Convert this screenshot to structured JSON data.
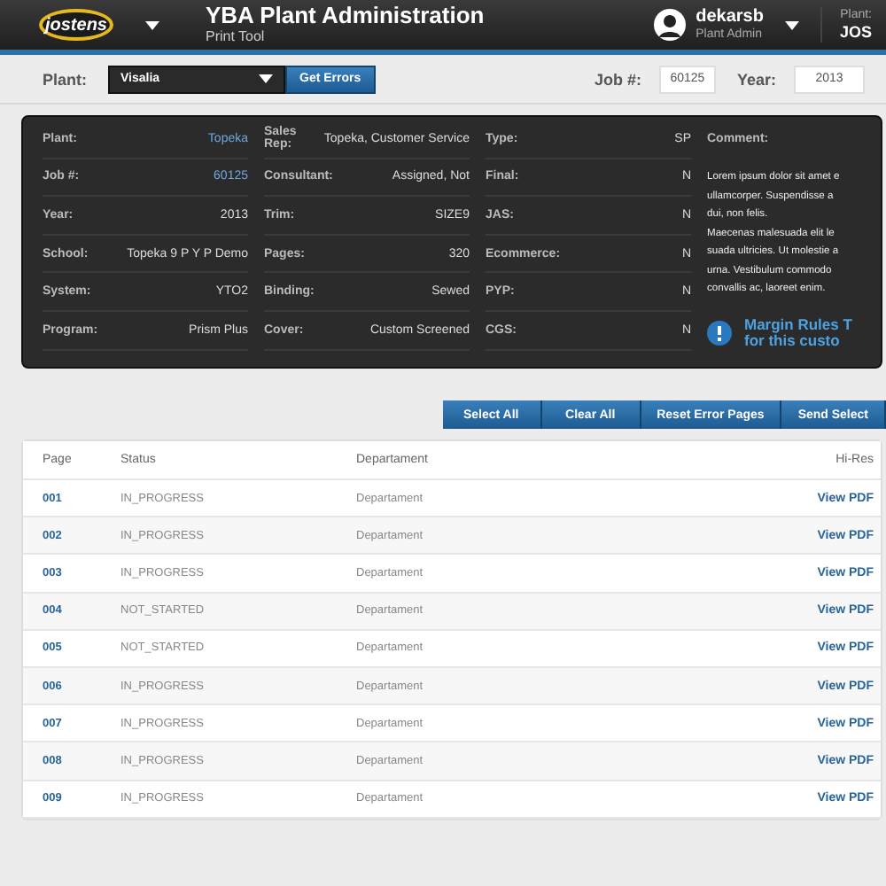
{
  "header": {
    "logo": "jostens",
    "title": "YBA Plant Administration",
    "subtitle": "Print Tool",
    "user": {
      "name": "dekarsb",
      "role": "Plant Admin"
    },
    "plant": {
      "label": "Plant:",
      "value": "JOS"
    }
  },
  "toolbar": {
    "plant_label": "Plant:",
    "plant_value": "Visalia",
    "get_errors": "Get Errors",
    "job_label": "Job #:",
    "job_value": "60125",
    "year_label": "Year:",
    "year_value": "2013"
  },
  "info": {
    "columns": [
      [
        {
          "label": "Plant:",
          "value": "Topeka",
          "link": true
        },
        {
          "label": "Job #:",
          "value": "60125",
          "link": true
        },
        {
          "label": "Year:",
          "value": "2013",
          "link": false
        },
        {
          "label": "School:",
          "value": "Topeka 9 P Y P Demo",
          "link": false
        },
        {
          "label": "System:",
          "value": "YTO2",
          "link": false
        },
        {
          "label": "Program:",
          "value": "Prism Plus",
          "link": false
        }
      ],
      [
        {
          "label": "Sales Rep:",
          "value": "Topeka, Customer Service",
          "link": false
        },
        {
          "label": "Consultant:",
          "value": "Assigned, Not",
          "link": false
        },
        {
          "label": "Trim:",
          "value": "SIZE9",
          "link": false
        },
        {
          "label": "Pages:",
          "value": "320",
          "link": false
        },
        {
          "label": "Binding:",
          "value": "Sewed",
          "link": false
        },
        {
          "label": "Cover:",
          "value": "Custom Screened",
          "link": false
        }
      ],
      [
        {
          "label": "Type:",
          "value": "SP",
          "link": false
        },
        {
          "label": "Final:",
          "value": "N",
          "link": false
        },
        {
          "label": "JAS:",
          "value": "N",
          "link": false
        },
        {
          "label": "Ecommerce:",
          "value": "N",
          "link": false
        },
        {
          "label": "PYP:",
          "value": "N",
          "link": false
        },
        {
          "label": "CGS:",
          "value": "N",
          "link": false
        }
      ]
    ],
    "comment_label": "Comment:",
    "comment_lines": [
      "Lorem ipsum dolor sit amet e",
      "ullamcorper. Suspendisse a",
      "dui, non felis.",
      "Maecenas malesuada elit le",
      "suada ultricies. Ut molestie a",
      "urna. Vestibulum commodo",
      "convallis ac, laoreet enim."
    ],
    "notice_lines": [
      "Margin Rules T",
      "for this custo"
    ]
  },
  "actions": [
    "Select All",
    "Clear All",
    "Reset Error Pages",
    "Send Select"
  ],
  "table": {
    "columns": [
      "Page",
      "Status",
      "Departament",
      "Hi-Res"
    ],
    "rows": [
      {
        "page": "001",
        "status": "IN_PROGRESS",
        "department": "Departament",
        "hi_res": "View PDF"
      },
      {
        "page": "002",
        "status": "IN_PROGRESS",
        "department": "Departament",
        "hi_res": "View PDF"
      },
      {
        "page": "003",
        "status": "IN_PROGRESS",
        "department": "Departament",
        "hi_res": "View PDF"
      },
      {
        "page": "004",
        "status": "NOT_STARTED",
        "department": "Departament",
        "hi_res": "View PDF"
      },
      {
        "page": "005",
        "status": "NOT_STARTED",
        "department": "Departament",
        "hi_res": "View PDF"
      },
      {
        "page": "006",
        "status": "IN_PROGRESS",
        "department": "Departament",
        "hi_res": "View PDF"
      },
      {
        "page": "007",
        "status": "IN_PROGRESS",
        "department": "Departament",
        "hi_res": "View PDF"
      },
      {
        "page": "008",
        "status": "IN_PROGRESS",
        "department": "Departament",
        "hi_res": "View PDF"
      },
      {
        "page": "009",
        "status": "IN_PROGRESS",
        "department": "Departament",
        "hi_res": "View PDF"
      }
    ]
  }
}
